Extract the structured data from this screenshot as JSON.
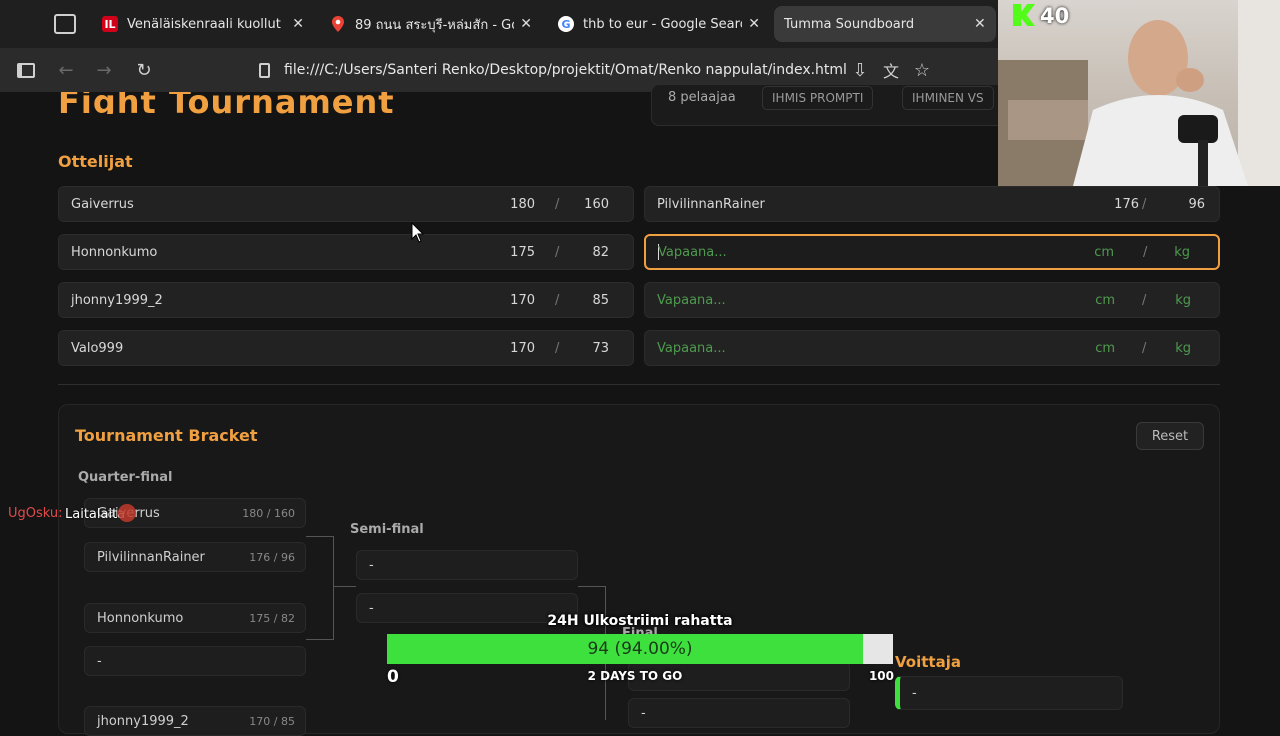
{
  "browser": {
    "tabs": [
      {
        "title": "Venäläiskenraali kuollut lentok",
        "favicon": "IL"
      },
      {
        "title": "89 ถนน สระบุรี-หล่มสัก - Goo",
        "favicon": "maps"
      },
      {
        "title": "thb to eur - Google Search",
        "favicon": "G"
      },
      {
        "title": "Tumma Soundboard",
        "favicon": ""
      }
    ],
    "url": "file:///C:/Users/Santeri Renko/Desktop/projektit/Omat/Renko nappulat/index.html"
  },
  "overlay": {
    "kick_count": "40",
    "chat_user": "UgOsku:",
    "chat_message": "Laitalaita"
  },
  "page": {
    "title": "Fight Tournament",
    "header_chips": [
      "8 pelaajaa",
      "IHMIS PROMPTI",
      "IHMINEN VS"
    ],
    "fighters_heading": "Ottelijat",
    "unit_cm": "cm",
    "unit_kg": "kg",
    "slash": "/",
    "fighters_left": [
      {
        "name": "Gaiverrus",
        "height": "180",
        "weight": "160"
      },
      {
        "name": "Honnonkumo",
        "height": "175",
        "weight": "82"
      },
      {
        "name": "jhonny1999_2",
        "height": "170",
        "weight": "85"
      },
      {
        "name": "Valo999",
        "height": "170",
        "weight": "73"
      }
    ],
    "fighters_right": [
      {
        "name": "PilvilinnanRainer",
        "height": "176",
        "weight": "96"
      },
      {
        "placeholder": "Vapaana..."
      },
      {
        "placeholder": "Vapaana..."
      },
      {
        "placeholder": "Vapaana..."
      }
    ],
    "bracket": {
      "heading": "Tournament Bracket",
      "reset_label": "Reset",
      "quarter_label": "Quarter-final",
      "semi_label": "Semi-final",
      "final_label": "Final",
      "winner_label": "Voittaja",
      "quarter": [
        {
          "name": "Gaiverrus",
          "score": "180 / 160"
        },
        {
          "name": "PilvilinnanRainer",
          "score": "176 / 96"
        },
        {
          "name": "Honnonkumo",
          "score": "175 / 82"
        },
        {
          "name": "-",
          "score": ""
        },
        {
          "name": "jhonny1999_2",
          "score": "170 / 85"
        }
      ],
      "semi": [
        "-",
        "-"
      ],
      "final": [
        "",
        "-"
      ],
      "winner": "-"
    }
  },
  "goal_widget": {
    "title": "24H Ulkostriimi rahatta",
    "progress_text": "94 (94.00%)",
    "progress_fraction": 0.94,
    "min": "0",
    "max": "100",
    "footer": "2 DAYS TO GO"
  }
}
